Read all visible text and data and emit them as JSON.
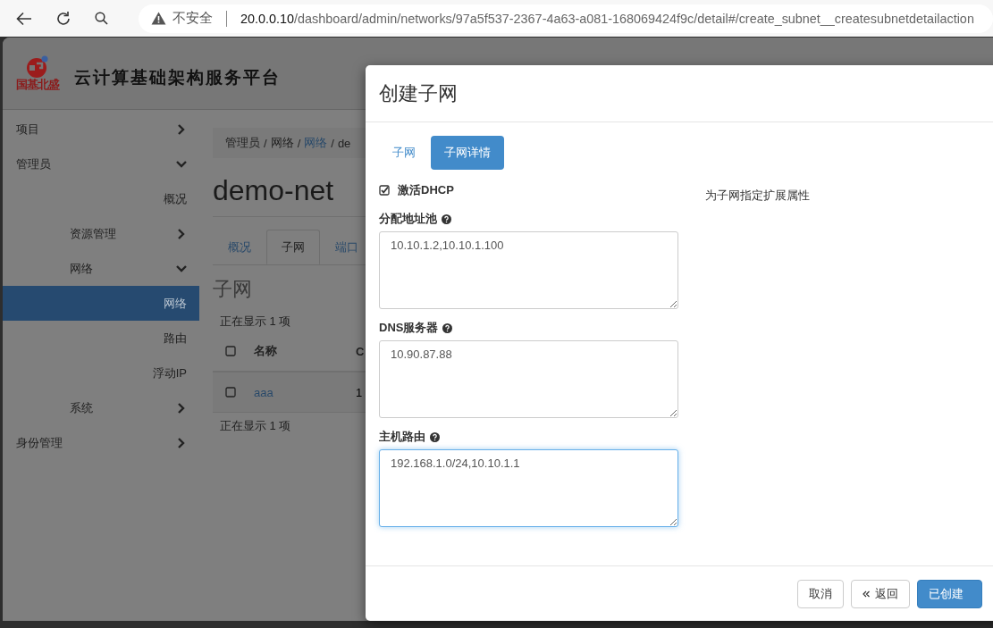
{
  "browser": {
    "security_label": "不安全",
    "url_host": "20.0.0.10",
    "url_path": "/dashboard/admin/networks/97a5f537-2367-4a63-a081-168069424f9c/detail#/create_subnet__createsubnetdetailaction"
  },
  "header": {
    "logo_text": "国基北盛",
    "title": "云计算基础架构服务平台"
  },
  "sidebar": {
    "items": [
      {
        "label": "项目",
        "expanded": false
      },
      {
        "label": "管理员",
        "expanded": true,
        "children": [
          {
            "label": "概况",
            "selected": false
          },
          {
            "label": "资源管理",
            "expanded": false
          },
          {
            "label": "网络",
            "expanded": true,
            "children": [
              {
                "label": "网络",
                "selected": true
              },
              {
                "label": "路由",
                "selected": false
              },
              {
                "label": "浮动IP",
                "selected": false
              }
            ]
          },
          {
            "label": "系统",
            "expanded": false
          }
        ]
      },
      {
        "label": "身份管理",
        "expanded": false
      }
    ]
  },
  "content": {
    "breadcrumb_separator": "/",
    "breadcrumb": [
      {
        "label": "管理员",
        "link": false
      },
      {
        "label": "网络",
        "link": false
      },
      {
        "label": "网络",
        "link": true
      },
      {
        "label": "de",
        "link": false
      }
    ],
    "title": "demo-net",
    "tabs": [
      {
        "label": "概况",
        "selected": false
      },
      {
        "label": "子网",
        "selected": true
      },
      {
        "label": "端口",
        "selected": false
      }
    ],
    "section_title": "子网",
    "count_top": "正在显示 1 项",
    "table": {
      "columns": [
        {
          "label": "名称"
        },
        {
          "label": "C"
        }
      ],
      "rows": [
        {
          "checked": false,
          "cells": [
            "aaa",
            "1"
          ]
        }
      ],
      "header_checked": false
    },
    "count_bottom": "正在显示 1 项"
  },
  "modal": {
    "title": "创建子网",
    "tabs": [
      {
        "label": "子网",
        "selected": false
      },
      {
        "label": "子网详情",
        "selected": true
      }
    ],
    "dhcp": {
      "label": "激活DHCP",
      "checked": true
    },
    "fields": [
      {
        "label": "分配地址池",
        "value": "10.10.1.2,10.10.1.100",
        "focused": false
      },
      {
        "label": "DNS服务器",
        "value": "10.90.87.88",
        "focused": false
      },
      {
        "label": "主机路由",
        "value": "192.168.1.0/24,10.10.1.1",
        "focused": true
      }
    ],
    "help": "为子网指定扩展属性",
    "buttons": [
      {
        "label": "取消",
        "kind": "default"
      },
      {
        "label": "返回",
        "kind": "back"
      },
      {
        "label": "已创建",
        "kind": "primary"
      }
    ]
  }
}
